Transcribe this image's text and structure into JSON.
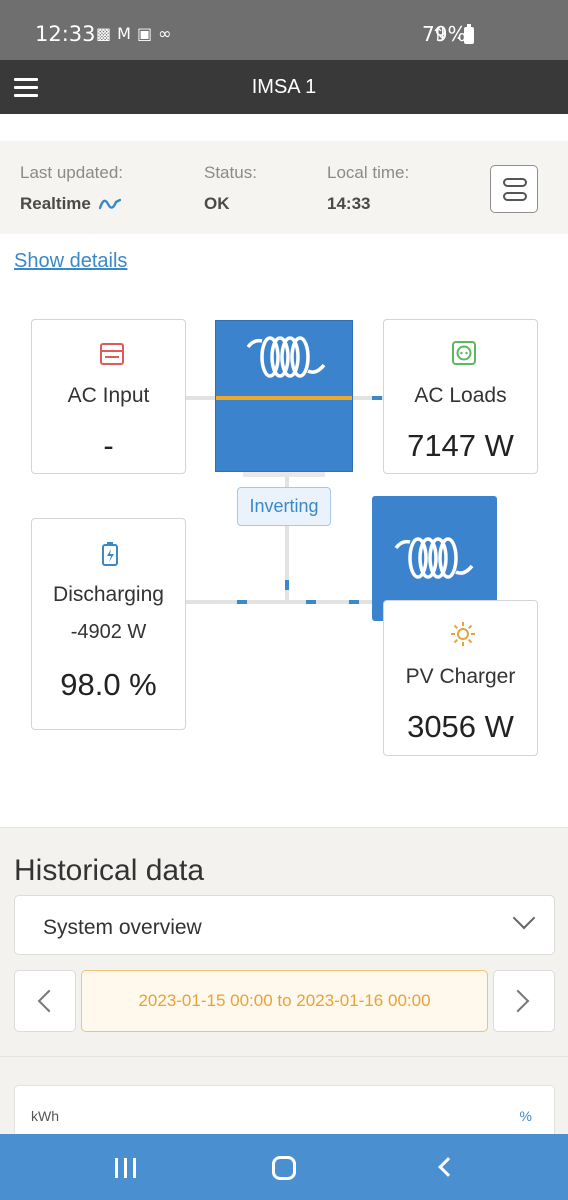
{
  "status_bar": {
    "time": "12:33",
    "left_icons": [
      "chat-icon",
      "gmail-icon",
      "gallery-icon",
      "voicemail-icon"
    ],
    "battery": "79%"
  },
  "app_bar": {
    "title": "IMSA 1",
    "menu_icon": "hamburger-icon"
  },
  "info": {
    "last_updated_label": "Last updated:",
    "last_updated_value": "Realtime",
    "status_label": "Status:",
    "status_value": "OK",
    "local_time_label": "Local time:",
    "local_time_value": "14:33"
  },
  "show_details": "Show details",
  "flow": {
    "ac_input": {
      "title": "AC Input",
      "value": "-"
    },
    "ac_loads": {
      "title": "AC Loads",
      "value": "7147 W"
    },
    "inverter_state": "Inverting",
    "battery": {
      "title": "Discharging",
      "power": "-4902 W",
      "soc": "98.0 %"
    },
    "pv_charger": {
      "title": "PV Charger",
      "value": "3056 W"
    }
  },
  "historical": {
    "title": "Historical data",
    "select_value": "System overview",
    "date_range": "2023-01-15 00:00 to 2023-01-16 00:00",
    "chart_unit_left": "kWh",
    "chart_unit_right": "%"
  },
  "colors": {
    "accent": "#3a88c8",
    "inverter_blue": "#3c83cd",
    "orange": "#e8a23a",
    "navbar": "#4a8fd0"
  }
}
